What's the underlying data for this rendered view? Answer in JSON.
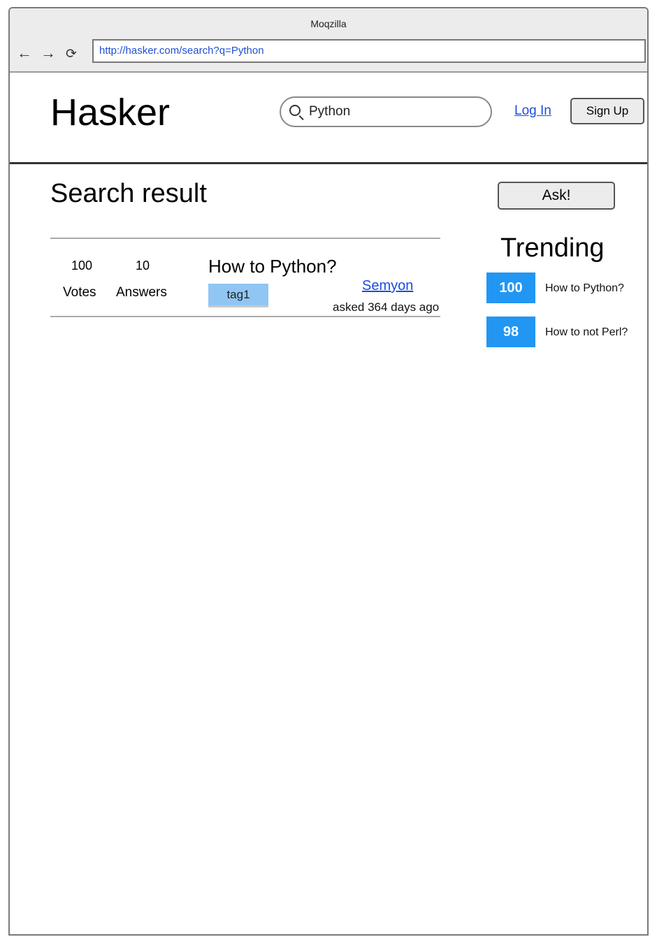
{
  "browser": {
    "window_title": "Moqzilla",
    "url": "http://hasker.com/search?q=Python",
    "icons": {
      "back": "arrow-left-icon",
      "forward": "arrow-right-icon",
      "reload": "reload-icon"
    }
  },
  "header": {
    "brand": "Hasker",
    "search": {
      "value": "Python",
      "icon": "search-icon"
    },
    "login_label": "Log In",
    "signup_label": "Sign Up"
  },
  "main": {
    "title": "Search result",
    "results": [
      {
        "votes": "100",
        "votes_label": "Votes",
        "answers": "10",
        "answers_label": "Answers",
        "title": "How to Python?",
        "tags": [
          "tag1"
        ],
        "author": "Semyon",
        "asked": "asked 364 days ago"
      }
    ]
  },
  "sidebar": {
    "ask_label": "Ask!",
    "trending_title": "Trending",
    "trending": [
      {
        "count": "100",
        "title": "How to Python?"
      },
      {
        "count": "98",
        "title": "How to not Perl?"
      }
    ]
  },
  "colors": {
    "link": "#1a4de0",
    "accent": "#2196f3",
    "tag": "#90c6f4"
  }
}
